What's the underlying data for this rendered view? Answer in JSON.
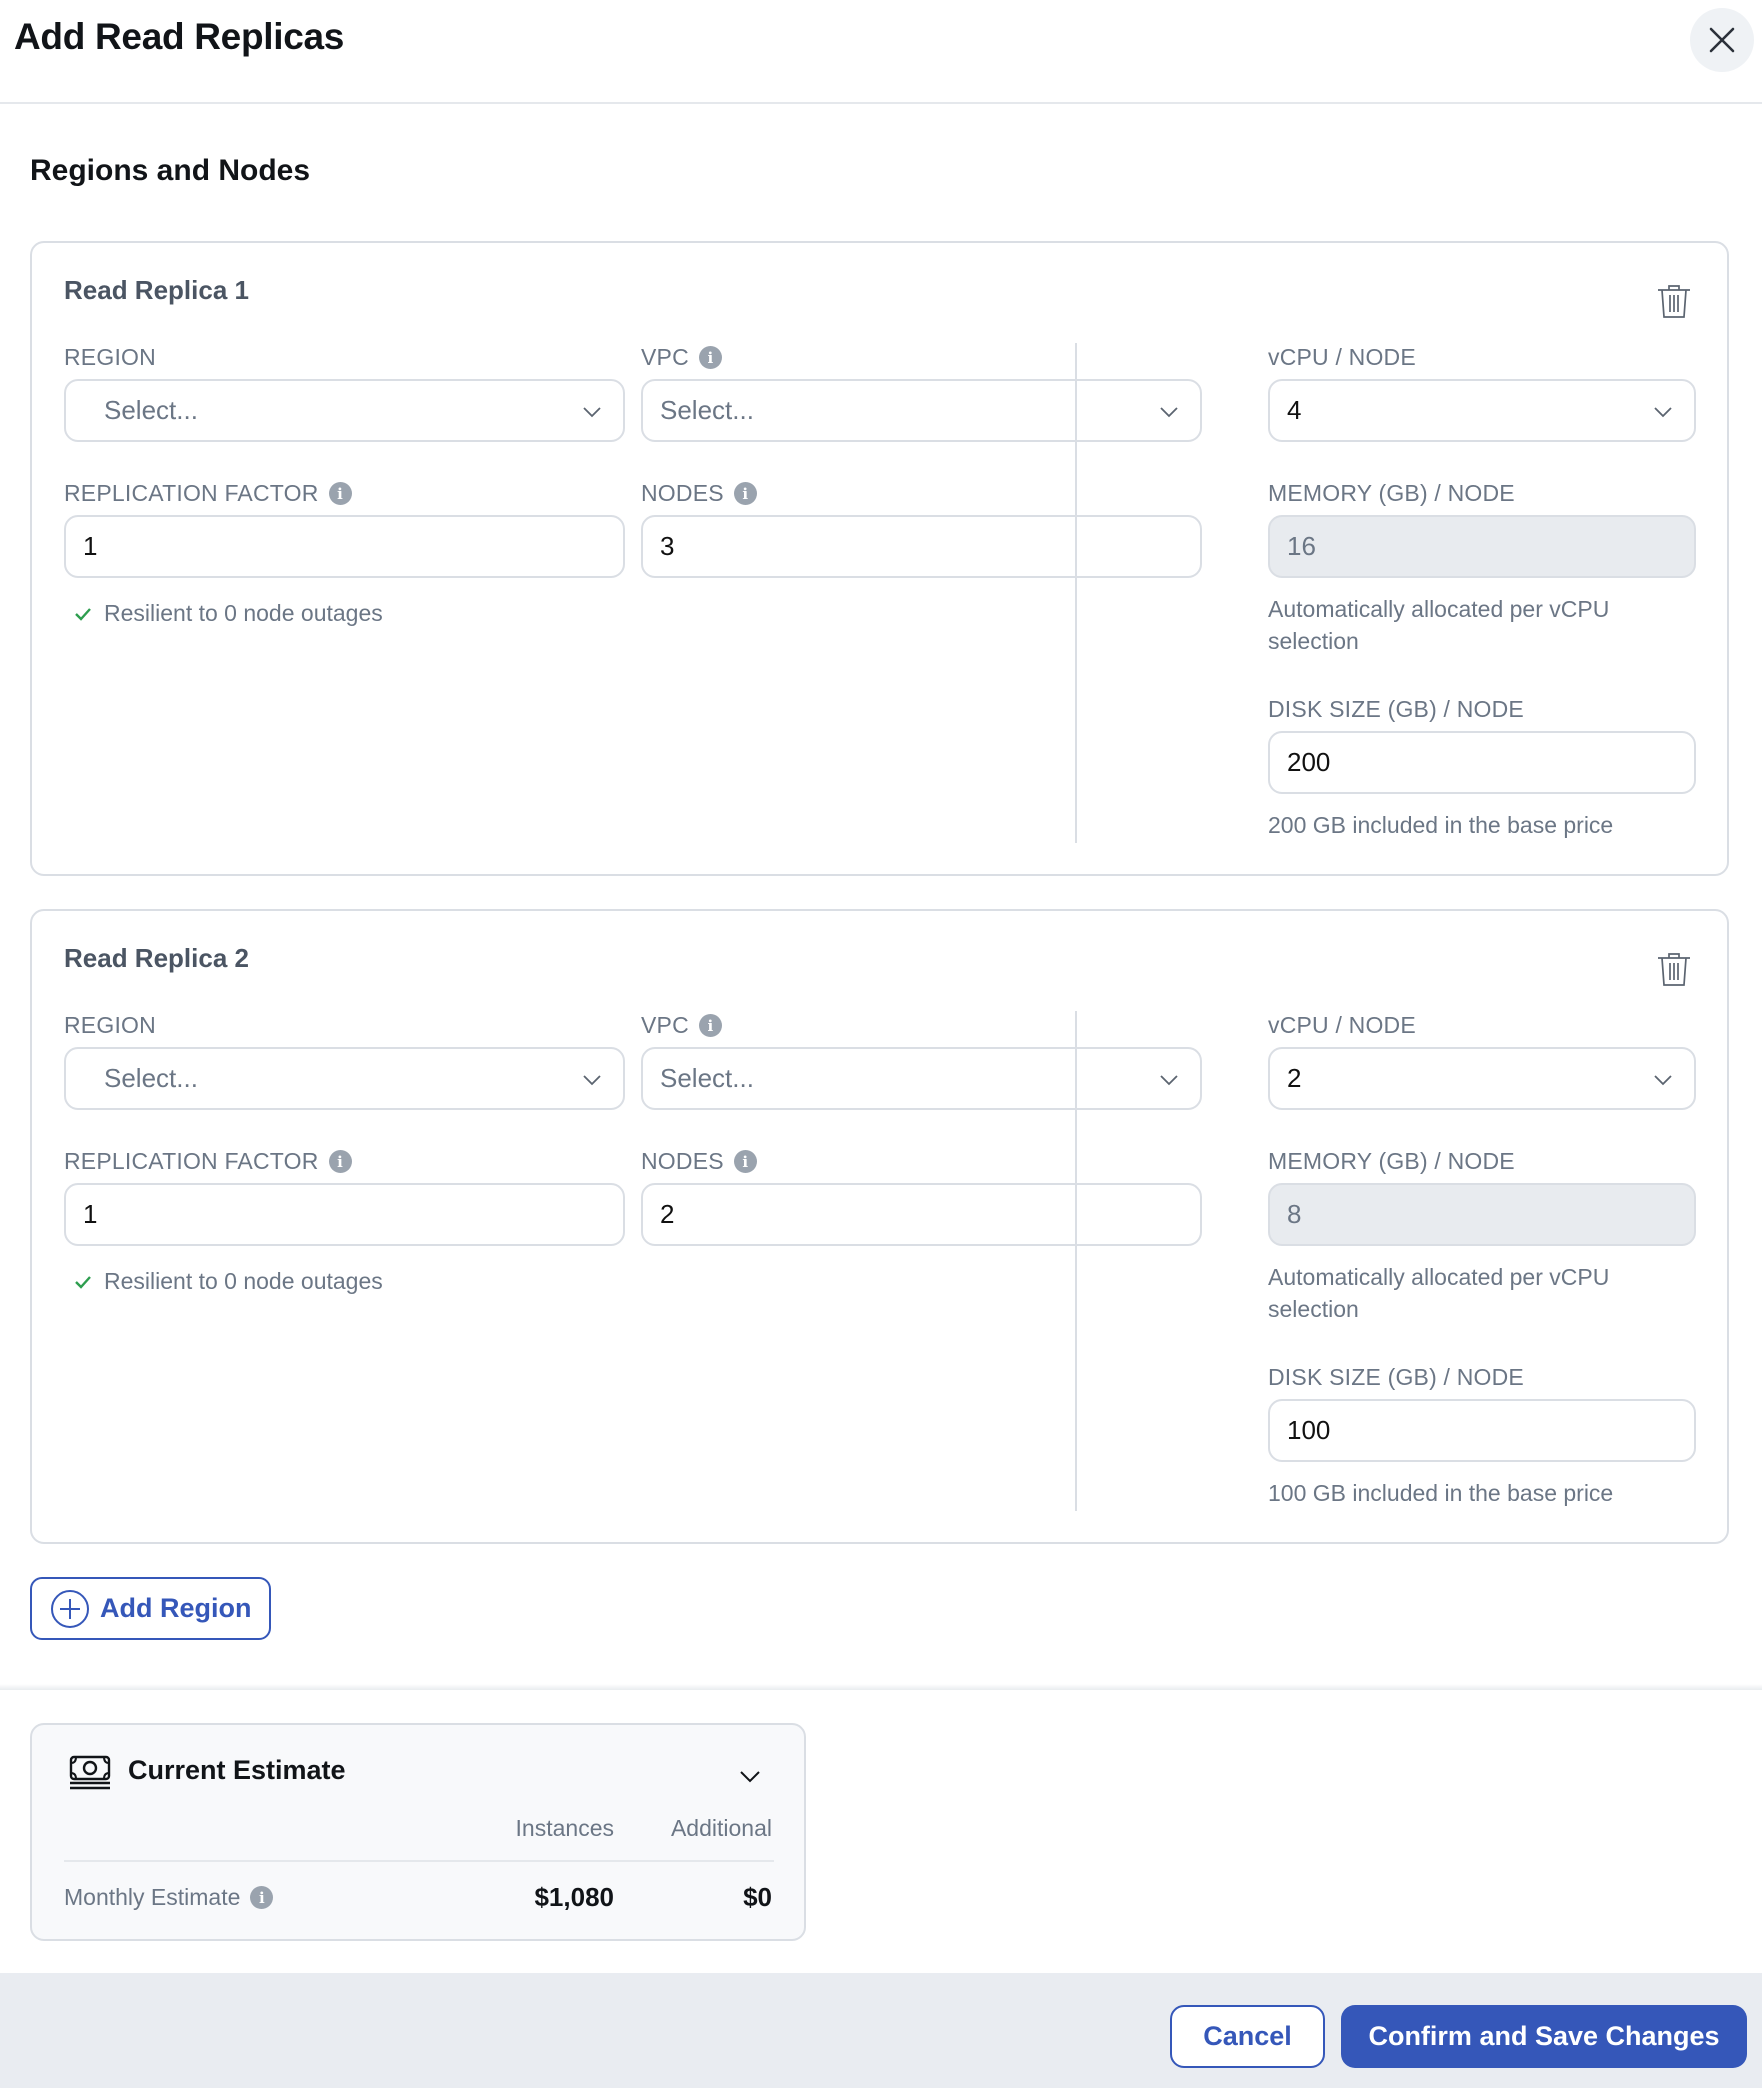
{
  "header": {
    "title": "Add Read Replicas",
    "close_icon": "close-icon"
  },
  "section_title": "Regions and Nodes",
  "labels": {
    "region": "REGION",
    "vpc": "VPC",
    "replication_factor": "REPLICATION FACTOR",
    "nodes": "NODES",
    "vcpu": "vCPU / NODE",
    "memory": "MEMORY (GB) / NODE",
    "disk": "DISK SIZE (GB) / NODE",
    "memory_helper": "Automatically allocated per vCPU selection",
    "resilience": "Resilient to 0 node outages"
  },
  "replicas": [
    {
      "title": "Read Replica 1",
      "region_placeholder": "Select...",
      "vpc_placeholder": "Select...",
      "replication_factor": "1",
      "nodes": "3",
      "vcpu": "4",
      "memory": "16",
      "disk": "200",
      "disk_helper": "200 GB included in the base price"
    },
    {
      "title": "Read Replica 2",
      "region_placeholder": "Select...",
      "vpc_placeholder": "Select...",
      "replication_factor": "1",
      "nodes": "2",
      "vcpu": "2",
      "memory": "8",
      "disk": "100",
      "disk_helper": "100 GB included in the base price"
    }
  ],
  "add_region_label": "Add Region",
  "estimate": {
    "title": "Current Estimate",
    "col_instances": "Instances",
    "col_additional": "Additional",
    "row_label": "Monthly Estimate",
    "instances_value": "$1,080",
    "additional_value": "$0"
  },
  "footer": {
    "cancel_label": "Cancel",
    "confirm_label": "Confirm and Save Changes"
  },
  "colors": {
    "primary": "#3557b9",
    "success": "#2e9e4f",
    "border": "#dadee4",
    "footer_bg": "#e9ecf1"
  }
}
